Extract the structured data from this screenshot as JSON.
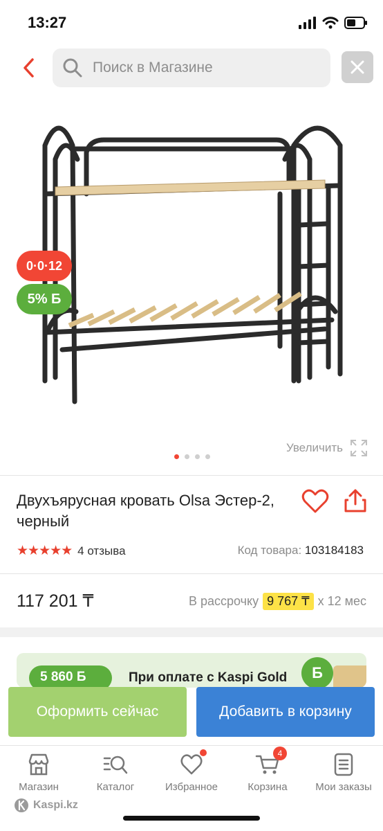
{
  "status": {
    "time": "13:27"
  },
  "search": {
    "placeholder": "Поиск в Магазине"
  },
  "badges": {
    "installment": "0·0·12",
    "bonus": "5% Б"
  },
  "gallery": {
    "zoom_label": "Увеличить",
    "slides": 4,
    "active_slide": 1
  },
  "product": {
    "title": "Двухъярусная кровать Olsa Эстер-2, черный",
    "rating": 4.5,
    "stars": "★★★★★",
    "reviews": "4 отзыва",
    "code_label": "Код товара:",
    "code": "103184183",
    "price": "117 201 ₸",
    "installment_label": "В рассрочку",
    "installment_amount": "9 767 ₸",
    "installment_term": "x 12 мес"
  },
  "promo": {
    "bonus": "5 860 Б",
    "text": "При оплате с Kaspi Gold",
    "coin": "Б"
  },
  "actions": {
    "order": "Оформить сейчас",
    "add_to_cart": "Добавить в корзину"
  },
  "tabs": [
    {
      "label": "Магазин",
      "icon": "shop-icon"
    },
    {
      "label": "Каталог",
      "icon": "catalog-search-icon"
    },
    {
      "label": "Избранное",
      "icon": "heart-icon"
    },
    {
      "label": "Корзина",
      "icon": "cart-icon",
      "count": "4"
    },
    {
      "label": "Мои заказы",
      "icon": "orders-icon"
    }
  ],
  "footer": {
    "brand": "Kaspi.kz"
  },
  "colors": {
    "accent": "#f14635",
    "green": "#5cae3d",
    "blue": "#3b82d6",
    "light_green": "#a3d16f",
    "highlight": "#fde247"
  }
}
